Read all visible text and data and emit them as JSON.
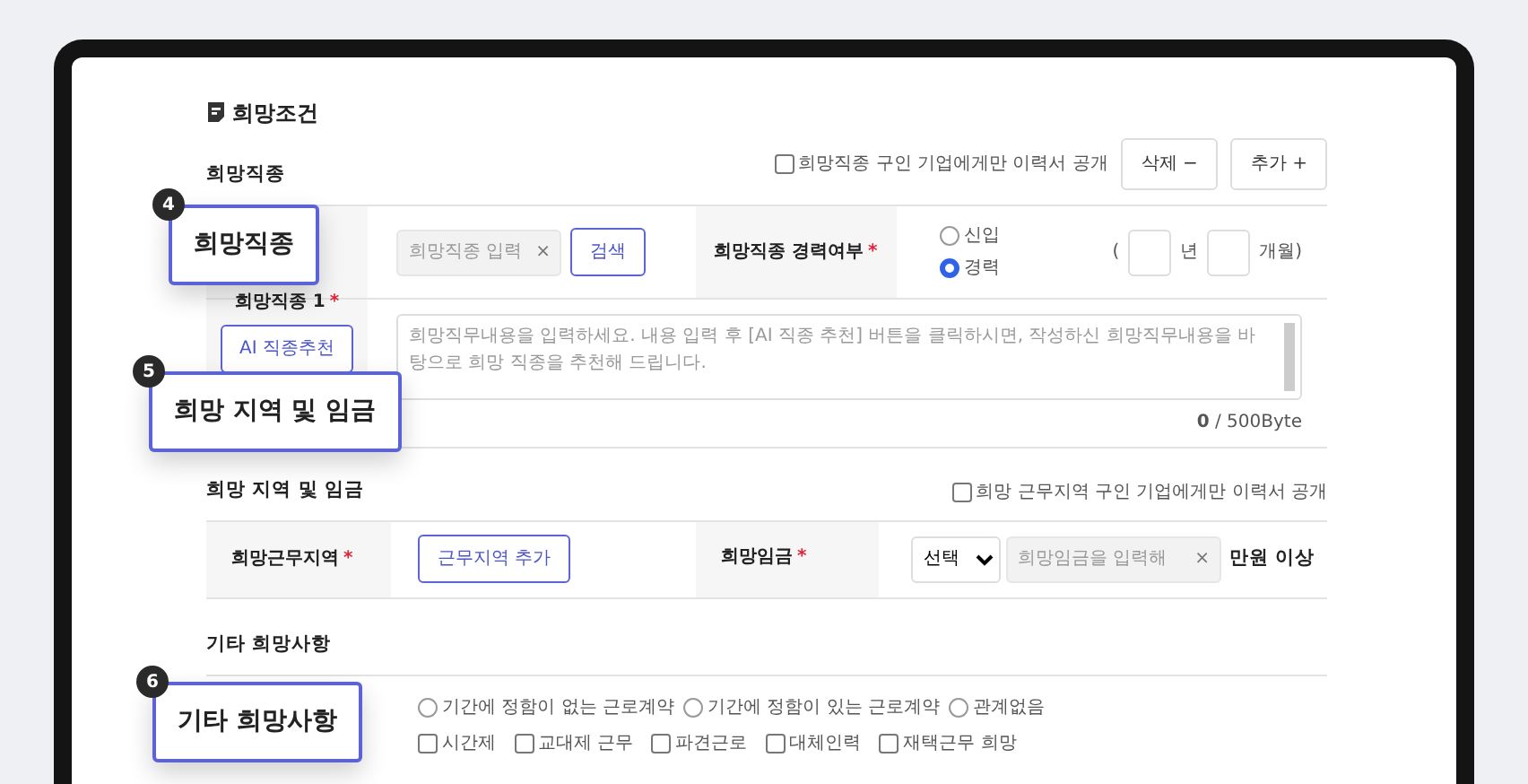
{
  "section_title": "희망조건",
  "job": {
    "heading": "희망직종",
    "public_only": {
      "label": "희망직종 구인 기업에게만 이력서 공개",
      "checked": false
    },
    "buttons": [
      {
        "label": "삭제",
        "symbol": "−"
      },
      {
        "label": "추가",
        "symbol": "+"
      }
    ],
    "job_field": {
      "placeholder": "희망직종 입력",
      "clear": "×"
    },
    "search_button": "검색",
    "career_label": "희망직종 경력여부",
    "required": "*",
    "career_options": [
      {
        "label": "신입",
        "selected": false
      },
      {
        "label": "경력",
        "selected": true
      }
    ],
    "period": {
      "open": "(",
      "years_unit": "년",
      "months_unit": "개월)"
    },
    "job_label": "희망직종 1",
    "job_required": "*",
    "ai_button": "AI 직종추천",
    "description": {
      "placeholder": "희망직무내용을 입력하세요. 내용 입력 후 [AI 직종 추천] 버튼을 클릭하시면, 작성하신 희망직무내용을 바탕으로 희망 직종을 추천해 드립니다."
    },
    "counter": "**0** / 500Byte"
  },
  "region": {
    "heading": "희망 지역 및 임금",
    "public_only": {
      "label": "희망 근무지역 구인 기업에게만 이력서 공개",
      "checked": false
    },
    "area_label": "희망근무지역",
    "area_required": "*",
    "area_button": "근무지역 추가",
    "wage_label": "희망임금",
    "wage_required": "*",
    "wage_select": "선택",
    "wage_field": {
      "placeholder": "희망임금을 입력해",
      "clear": "×"
    },
    "wage_suffix": "만원 이상"
  },
  "etc": {
    "heading": "기타 희망사항",
    "contract_options": [
      {
        "label": "기간에 정함이 없는 근로계약",
        "selected": false
      },
      {
        "label": "기간에 정함이 있는 근로계약",
        "selected": false
      },
      {
        "label": "관계없음",
        "selected": false
      }
    ],
    "work_types": [
      {
        "label": "시간제",
        "checked": false
      },
      {
        "label": "교대제 근무",
        "checked": false
      },
      {
        "label": "파견근로",
        "checked": false
      },
      {
        "label": "대체인력",
        "checked": false
      },
      {
        "label": "재택근무 희망",
        "checked": false
      }
    ]
  },
  "callouts": [
    {
      "number": "4",
      "label": "희망직종"
    },
    {
      "number": "5",
      "label": "희망 지역 및 임금"
    },
    {
      "number": "6",
      "label": "기타 희망사항"
    }
  ]
}
